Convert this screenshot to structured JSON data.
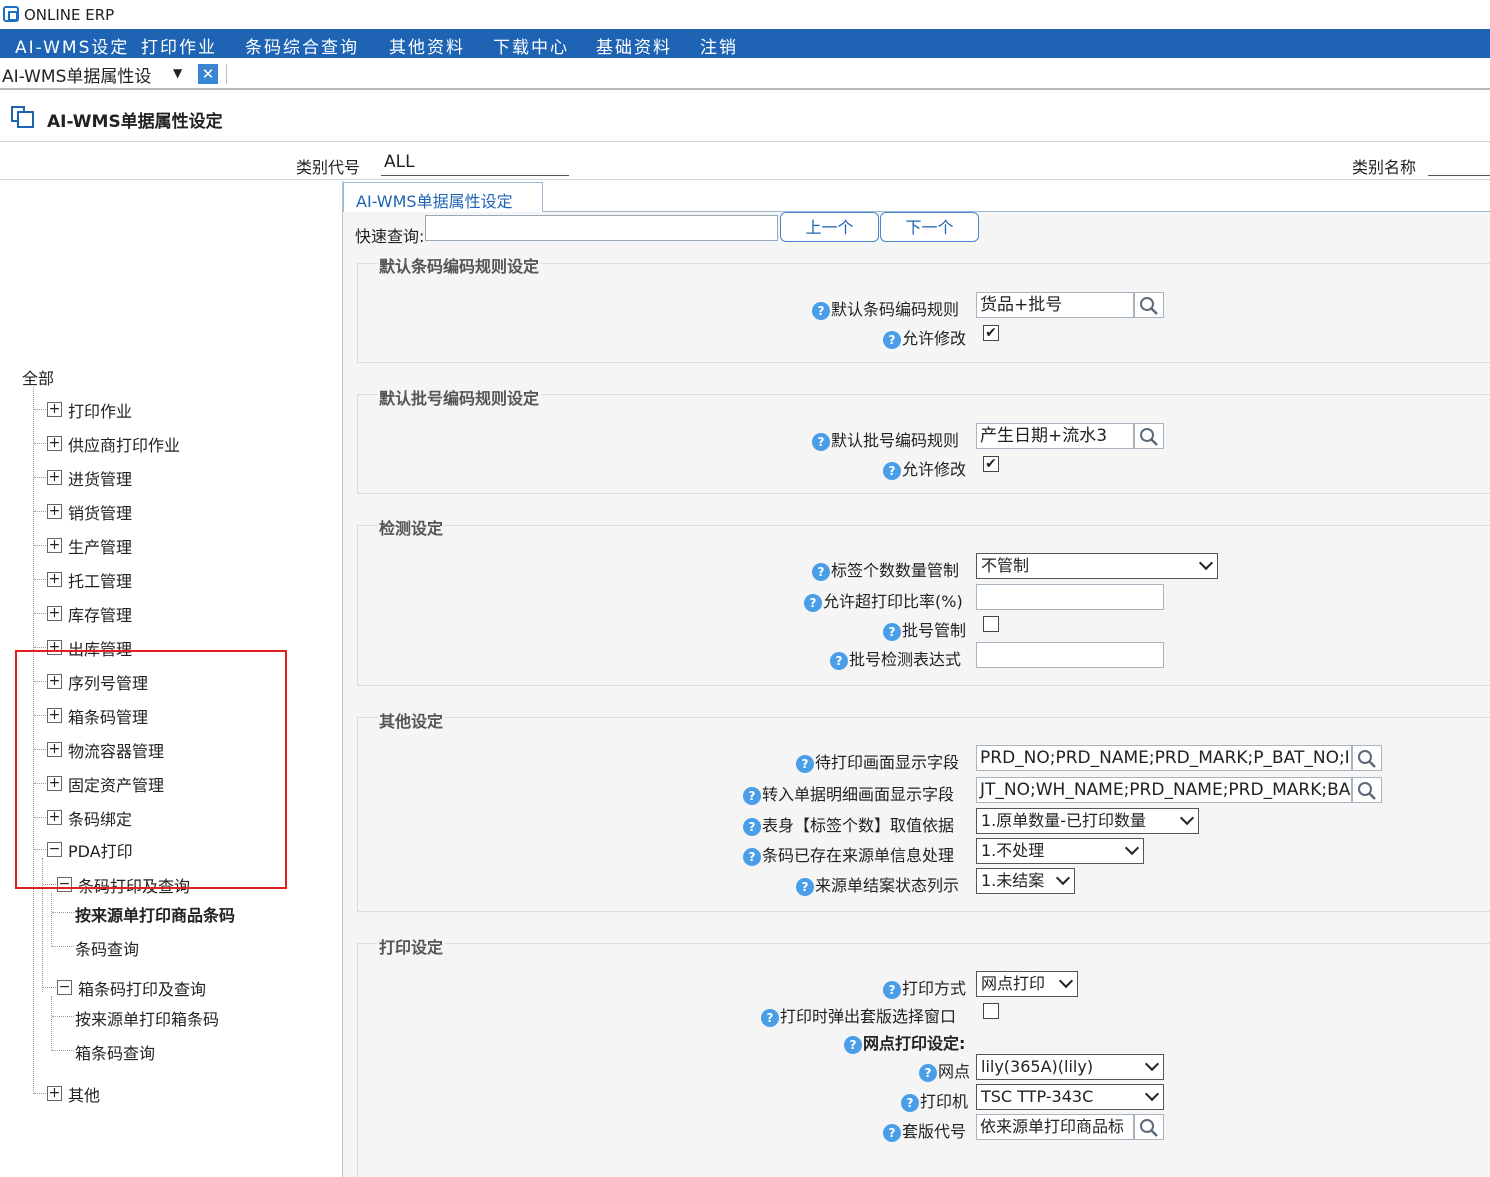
{
  "app": {
    "title": "ONLINE ERP"
  },
  "menu": [
    "AI-WMS设定",
    "打印作业",
    "条码综合查询",
    "其他资料",
    "下载中心",
    "基础资料",
    "注销"
  ],
  "tab": {
    "label": "AI-WMS单据属性设",
    "close": "✕"
  },
  "page": {
    "title": "AI-WMS单据属性设定"
  },
  "header": {
    "category_code_label": "类别代号",
    "category_code_value": "ALL",
    "category_name_label": "类别名称",
    "category_name_value": ""
  },
  "tree": {
    "root": "全部",
    "items": [
      "打印作业",
      "供应商打印作业",
      "进货管理",
      "销货管理",
      "生产管理",
      "托工管理",
      "库存管理",
      "出库管理",
      "序列号管理",
      "箱条码管理",
      "物流容器管理",
      "固定资产管理",
      "条码绑定"
    ],
    "pda": {
      "label": "PDA打印",
      "group1": {
        "label": "条码打印及查询",
        "children": [
          "按来源单打印商品条码",
          "条码查询"
        ]
      },
      "group2": {
        "label": "箱条码打印及查询",
        "children": [
          "按来源单打印箱条码",
          "箱条码查询"
        ]
      }
    },
    "other": "其他",
    "expand_glyph": "+",
    "collapse_glyph": "−"
  },
  "content_tab": {
    "label": "AI-WMS单据属性设定"
  },
  "quick": {
    "label": "快速查询:",
    "value": "",
    "prev": "上一个",
    "next": "下一个"
  },
  "sections": {
    "barcode_rule": {
      "title": "默认条码编码规则设定",
      "rule_label": "默认条码编码规则",
      "rule_value": "货品+批号",
      "allow_label": "允许修改",
      "allow_checked": true
    },
    "batch_rule": {
      "title": "默认批号编码规则设定",
      "rule_label": "默认批号编码规则",
      "rule_value": "产生日期+流水3",
      "allow_label": "允许修改",
      "allow_checked": true
    },
    "check": {
      "title": "检测设定",
      "label_qty_label": "标签个数数量管制",
      "label_qty_value": "不管制",
      "over_print_label": "允许超打印比率(%)",
      "over_print_value": "",
      "batch_ctrl_label": "批号管制",
      "batch_ctrl_checked": false,
      "batch_expr_label": "批号检测表达式",
      "batch_expr_value": ""
    },
    "other": {
      "title": "其他设定",
      "pending_fields_label": "待打印画面显示字段",
      "pending_fields_value": "PRD_NO;PRD_NAME;PRD_MARK;P_BAT_NO;I",
      "transfer_fields_label": "转入单据明细画面显示字段",
      "transfer_fields_value": "JT_NO;WH_NAME;PRD_NAME;PRD_MARK;BA",
      "label_basis_label": "表身【标签个数】取值依据",
      "label_basis_value": "1.原单数量-已打印数量",
      "exist_handle_label": "条码已存在来源单信息处理",
      "exist_handle_value": "1.不处理",
      "closed_status_label": "来源单结案状态列示",
      "closed_status_value": "1.未结案"
    },
    "print": {
      "title": "打印设定",
      "mode_label": "打印方式",
      "mode_value": "网点打印",
      "popup_label": "打印时弹出套版选择窗口",
      "popup_checked": false,
      "site_settings_label": "网点打印设定:",
      "site_label": "网点",
      "site_value": "lily(365A)(lily)",
      "printer_label": "打印机",
      "printer_value": "TSC TTP-343C",
      "template_label": "套版代号",
      "template_value": "依来源单打印商品标"
    }
  },
  "help_glyph": "?",
  "check_glyph": "✔",
  "icons": {
    "search": "search-icon",
    "dropdown": "chevron-down-icon",
    "help": "help-icon"
  },
  "colors": {
    "menubar": "#1f64b4",
    "highlight": "#e02020",
    "help": "#4a9ee8"
  }
}
